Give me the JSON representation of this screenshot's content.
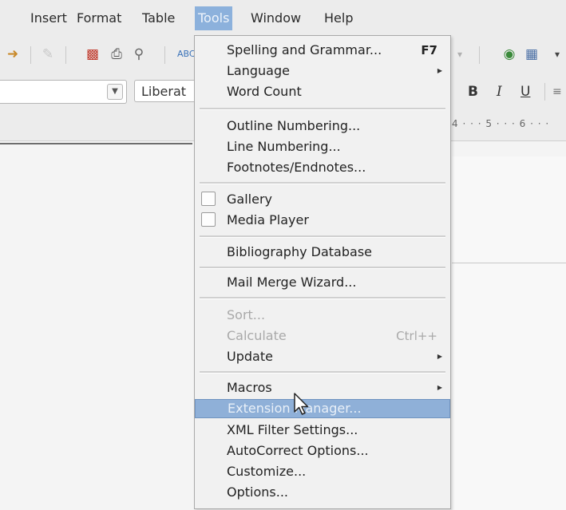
{
  "menubar": {
    "insert": "Insert",
    "format": "Format",
    "table": "Table",
    "tools": "Tools",
    "window": "Window",
    "help": "Help"
  },
  "toolbar": {
    "paragraph_style": "",
    "font_name": "Liberat",
    "bold": "B",
    "italic": "I",
    "underline": "U"
  },
  "ruler": {
    "scale": "4 · · · 5 · · · 6 · · ·"
  },
  "tools_menu": {
    "spelling": "Spelling and Grammar...",
    "spelling_shortcut": "F7",
    "language": "Language",
    "word_count": "Word Count",
    "outline_numbering": "Outline Numbering...",
    "line_numbering": "Line Numbering...",
    "footnotes": "Footnotes/Endnotes...",
    "gallery": "Gallery",
    "media_player": "Media Player",
    "bibliography": "Bibliography Database",
    "mail_merge": "Mail Merge Wizard...",
    "sort": "Sort...",
    "calculate": "Calculate",
    "calculate_shortcut": "Ctrl++",
    "update": "Update",
    "macros": "Macros",
    "extension_manager": "Extension Manager...",
    "xml_filter": "XML Filter Settings...",
    "autocorrect": "AutoCorrect Options...",
    "customize": "Customize...",
    "options": "Options..."
  },
  "colors": {
    "highlight": "#8fb0d8",
    "active_menu": "#8cb1dc",
    "menu_bg": "#f1f1f1"
  }
}
